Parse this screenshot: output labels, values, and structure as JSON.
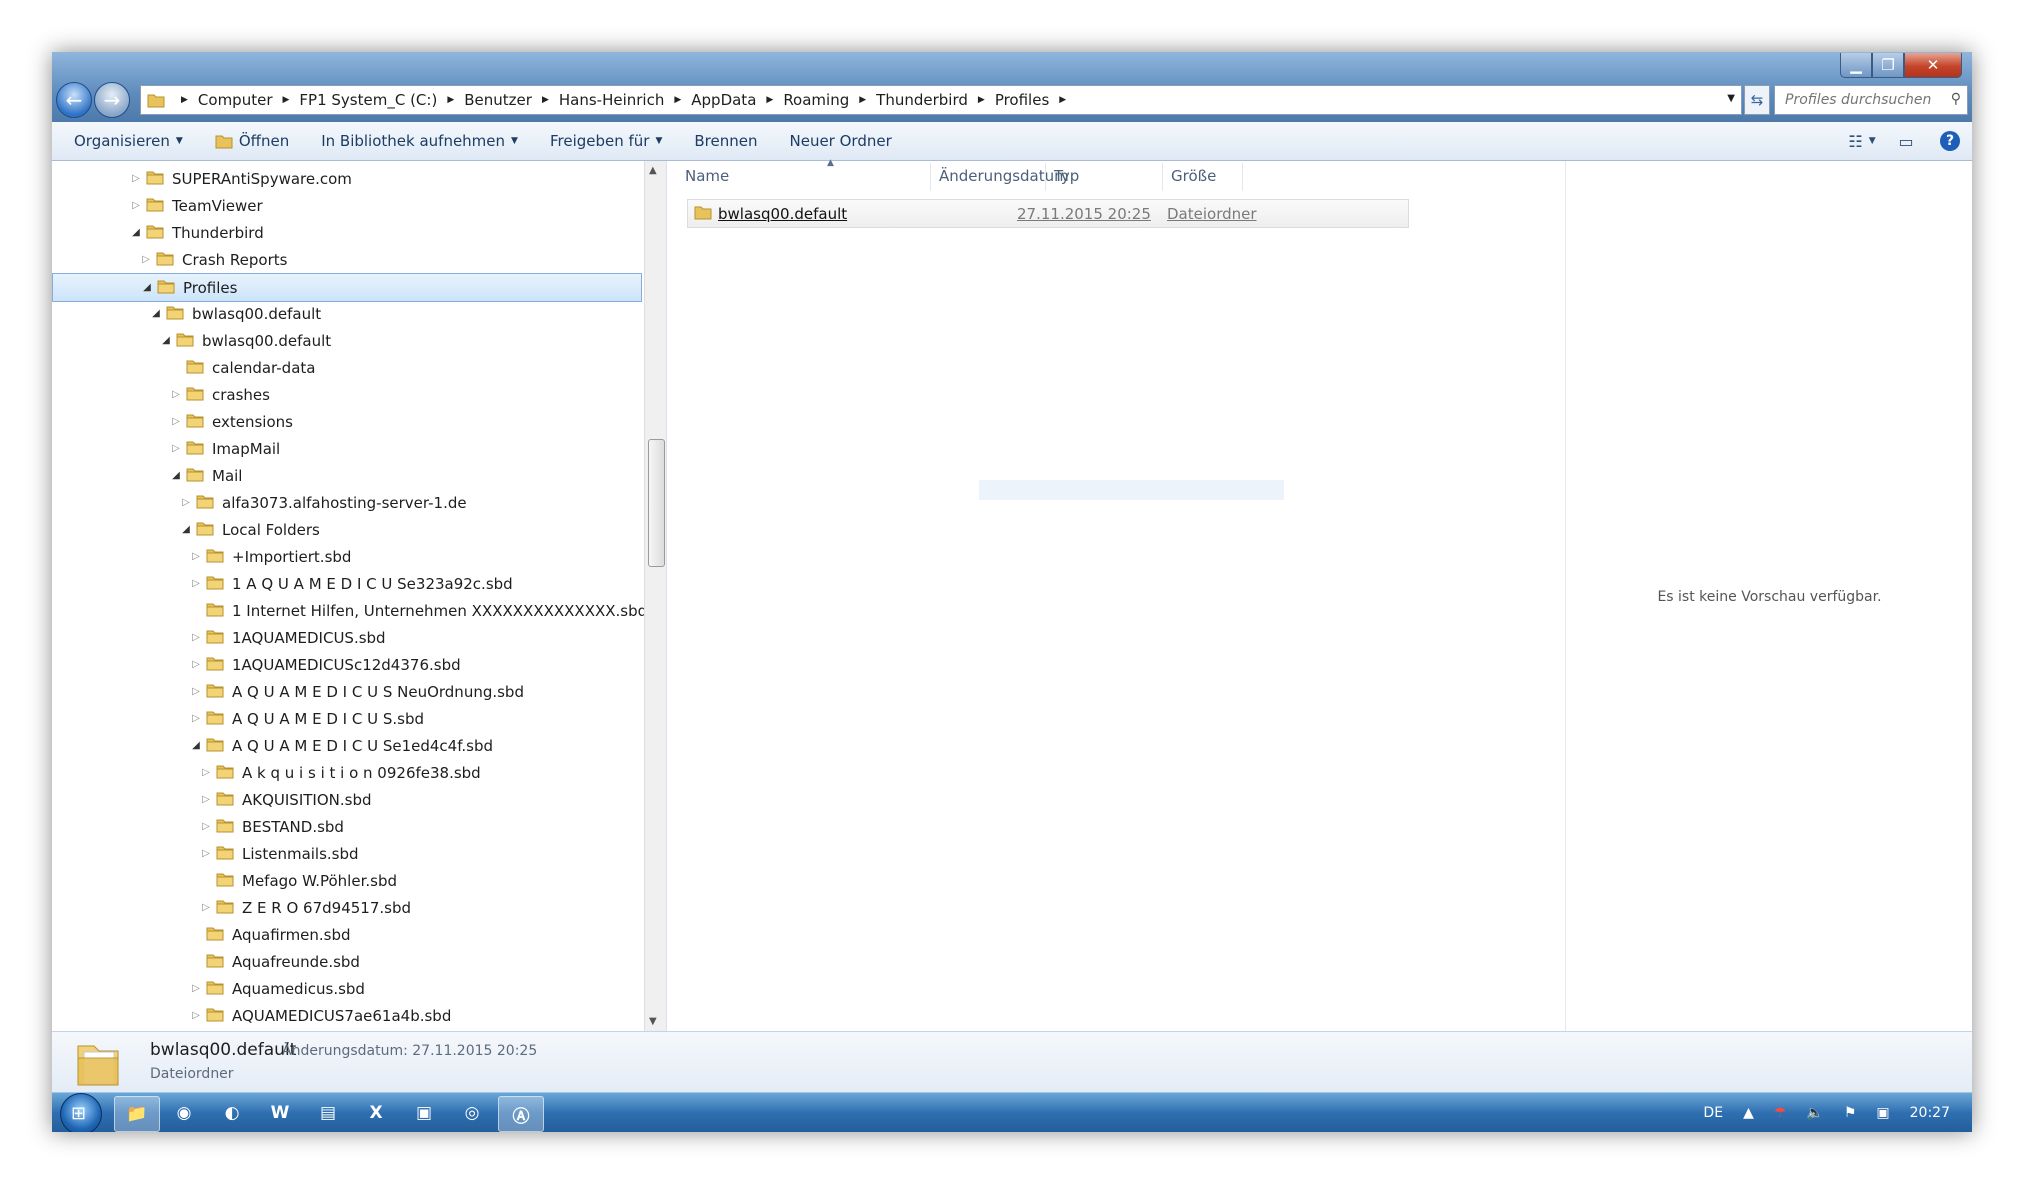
{
  "window": {
    "caption_minimize": "▁",
    "caption_maximize": "❐",
    "caption_close": "✕"
  },
  "nav": {
    "back_icon": "arrow-left",
    "forward_icon": "arrow-right",
    "breadcrumbs": [
      "Computer",
      "FP1 System_C (C:)",
      "Benutzer",
      "Hans-Heinrich",
      "AppData",
      "Roaming",
      "Thunderbird",
      "Profiles"
    ],
    "search_placeholder": "Profiles durchsuchen"
  },
  "toolbar": {
    "organize": "Organisieren",
    "open": "Öffnen",
    "library": "In Bibliothek aufnehmen",
    "share": "Freigeben für",
    "burn": "Brennen",
    "new_folder": "Neuer Ordner"
  },
  "tree": [
    {
      "label": "SUPERAntiSpyware.com",
      "level": 0,
      "toggle": "closed"
    },
    {
      "label": "TeamViewer",
      "level": 0,
      "toggle": "closed"
    },
    {
      "label": "Thunderbird",
      "level": 0,
      "toggle": "open"
    },
    {
      "label": "Crash Reports",
      "level": 1,
      "toggle": "closed"
    },
    {
      "label": "Profiles",
      "level": 1,
      "toggle": "open",
      "selected": true
    },
    {
      "label": "bwlasq00.default",
      "level": 2,
      "toggle": "open"
    },
    {
      "label": "bwlasq00.default",
      "level": 3,
      "toggle": "open"
    },
    {
      "label": "calendar-data",
      "level": 4,
      "toggle": "none"
    },
    {
      "label": "crashes",
      "level": 4,
      "toggle": "closed"
    },
    {
      "label": "extensions",
      "level": 4,
      "toggle": "closed"
    },
    {
      "label": "ImapMail",
      "level": 4,
      "toggle": "closed"
    },
    {
      "label": "Mail",
      "level": 4,
      "toggle": "open"
    },
    {
      "label": "alfa3073.alfahosting-server-1.de",
      "level": 5,
      "toggle": "closed"
    },
    {
      "label": "Local Folders",
      "level": 5,
      "toggle": "open"
    },
    {
      "label": "+Importiert.sbd",
      "level": 6,
      "toggle": "closed"
    },
    {
      "label": "1 A Q U A M E D I C U Se323a92c.sbd",
      "level": 6,
      "toggle": "closed"
    },
    {
      "label": "1 Internet Hilfen, Unternehmen XXXXXXXXXXXXXX.sbd",
      "level": 6,
      "toggle": "none"
    },
    {
      "label": "1AQUAMEDICUS.sbd",
      "level": 6,
      "toggle": "closed"
    },
    {
      "label": "1AQUAMEDICUSc12d4376.sbd",
      "level": 6,
      "toggle": "closed"
    },
    {
      "label": "A Q U A M E D I C U S NeuOrdnung.sbd",
      "level": 6,
      "toggle": "closed"
    },
    {
      "label": "A Q U A M E D I C U S.sbd",
      "level": 6,
      "toggle": "closed"
    },
    {
      "label": "A Q U A M E D I C U Se1ed4c4f.sbd",
      "level": 6,
      "toggle": "open"
    },
    {
      "label": "A k q u i s i t i o n 0926fe38.sbd",
      "level": 7,
      "toggle": "closed"
    },
    {
      "label": "AKQUISITION.sbd",
      "level": 7,
      "toggle": "closed"
    },
    {
      "label": "BESTAND.sbd",
      "level": 7,
      "toggle": "closed"
    },
    {
      "label": "Listenmails.sbd",
      "level": 7,
      "toggle": "closed"
    },
    {
      "label": "Mefago W.Pöhler.sbd",
      "level": 7,
      "toggle": "none"
    },
    {
      "label": "Z E R O  67d94517.sbd",
      "level": 7,
      "toggle": "closed"
    },
    {
      "label": "Aquafirmen.sbd",
      "level": 6,
      "toggle": "none"
    },
    {
      "label": "Aquafreunde.sbd",
      "level": 6,
      "toggle": "none"
    },
    {
      "label": "Aquamedicus.sbd",
      "level": 6,
      "toggle": "closed"
    },
    {
      "label": "AQUAMEDICUS7ae61a4b.sbd",
      "level": 6,
      "toggle": "closed"
    }
  ],
  "filelist": {
    "columns": [
      "Name",
      "Änderungsdatum",
      "Typ",
      "Größe"
    ],
    "rows": [
      {
        "name": "bwlasq00.default",
        "date": "27.11.2015 20:25",
        "type": "Dateiordner",
        "size": ""
      }
    ]
  },
  "preview": {
    "message": "Es ist keine Vorschau verfügbar."
  },
  "details": {
    "name": "bwlasq00.default",
    "date_label": "Änderungsdatum: 27.11.2015 20:25",
    "type": "Dateiordner"
  },
  "taskbar": {
    "apps": [
      "explorer",
      "firefox",
      "thunderbird",
      "word",
      "archive",
      "excel",
      "notepad",
      "media",
      "acrobat"
    ],
    "app_glyphs": [
      "📁",
      "◉",
      "◐",
      "W",
      "▤",
      "X",
      "▣",
      "◎",
      "Ⓐ"
    ],
    "language": "DE",
    "clock": "20:27"
  },
  "colors": {
    "accent": "#2e6fb1",
    "selection": "#cce4fa",
    "folder": "#e8c25a"
  }
}
